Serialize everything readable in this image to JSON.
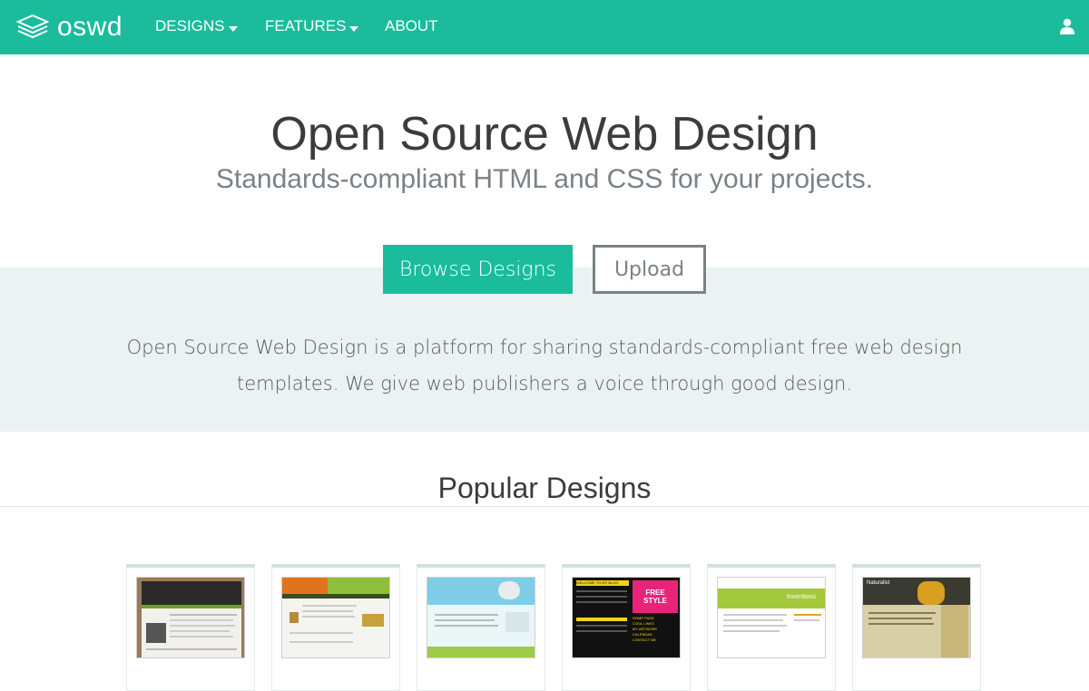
{
  "nav": {
    "logo_text": "oswd",
    "items": [
      {
        "label": "DESIGNS",
        "has_dropdown": true
      },
      {
        "label": "FEATURES",
        "has_dropdown": true
      },
      {
        "label": "ABOUT",
        "has_dropdown": false
      }
    ],
    "icons": {
      "logo": "stacked-layers-icon",
      "user": "user-icon"
    }
  },
  "hero": {
    "title": "Open Source Web Design",
    "subtitle": "Standards-compliant HTML and CSS for your projects.",
    "primary_button": "Browse Designs",
    "secondary_button": "Upload",
    "intro": "Open Source Web Design is a platform for sharing standards-compliant free web design templates. We give web publishers a voice through good design."
  },
  "popular": {
    "title": "Popular Designs",
    "thumb_texts": {
      "d4_banner": "WELCOME TO MY BLOG",
      "d4_tag": "FREE STYLE",
      "d4_list": [
        "HOME PAGE",
        "COOL LINKS",
        "MY ARTWORK",
        "CALENDAR",
        "CONTACT ME"
      ],
      "d5_title": "Inventions",
      "d6_title": "Naturalist"
    }
  },
  "colors": {
    "brand": "#1abc9c",
    "band": "#ebf3f2",
    "heading": "#3c3c3c",
    "muted": "#7a8288"
  }
}
